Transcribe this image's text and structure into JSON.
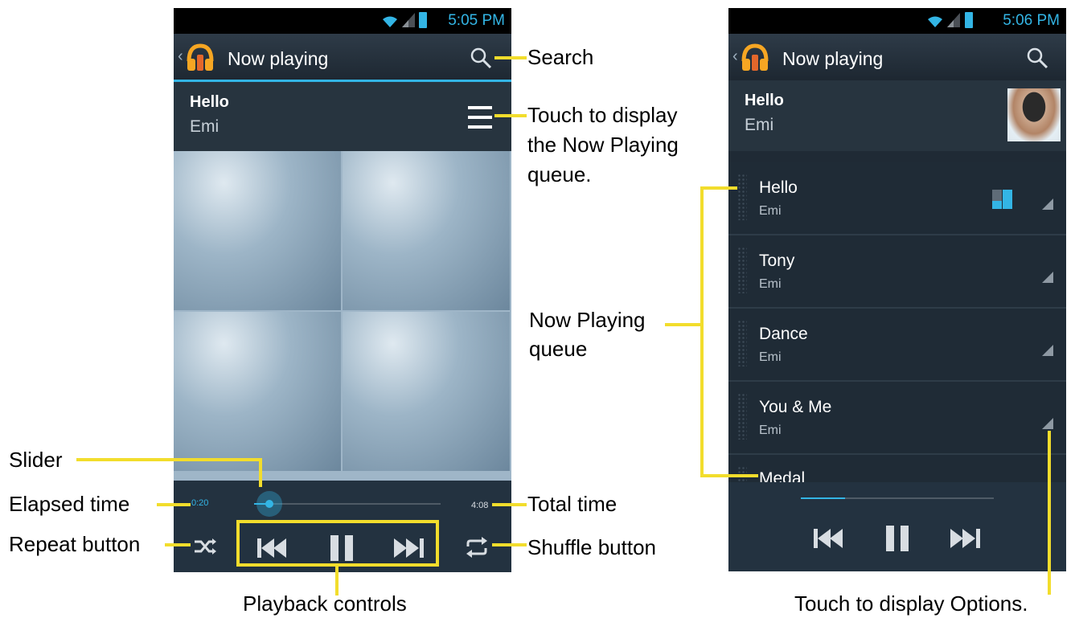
{
  "left_screen": {
    "status_time": "5:05 PM",
    "title": "Now playing",
    "track_title": "Hello",
    "track_artist": "Emi",
    "elapsed": "0:20",
    "total": "4:08",
    "progress": 0.08
  },
  "right_screen": {
    "status_time": "5:06 PM",
    "title": "Now playing",
    "track_title": "Hello",
    "track_artist": "Emi",
    "queue": [
      {
        "title": "Hello",
        "artist": "Emi"
      },
      {
        "title": "Tony",
        "artist": "Emi"
      },
      {
        "title": "Dance",
        "artist": "Emi"
      },
      {
        "title": "You & Me",
        "artist": "Emi"
      },
      {
        "title": "Medal",
        "artist": ""
      }
    ],
    "progress": 0.23
  },
  "callouts": {
    "search": "Search",
    "queue_touch_1": "Touch to display",
    "queue_touch_2": "the Now Playing",
    "queue_touch_3": "queue.",
    "slider": "Slider",
    "elapsed_time": "Elapsed time",
    "repeat_button": "Repeat button",
    "total_time": "Total time",
    "shuffle_button": "Shuffle button",
    "playback_controls": "Playback controls",
    "now_playing_queue_1": "Now Playing",
    "now_playing_queue_2": "queue",
    "options": "Touch to display Options."
  },
  "colors": {
    "accent": "#33b5e5",
    "callout": "#f2dd2c",
    "bar_bg": "#1f2a35"
  }
}
